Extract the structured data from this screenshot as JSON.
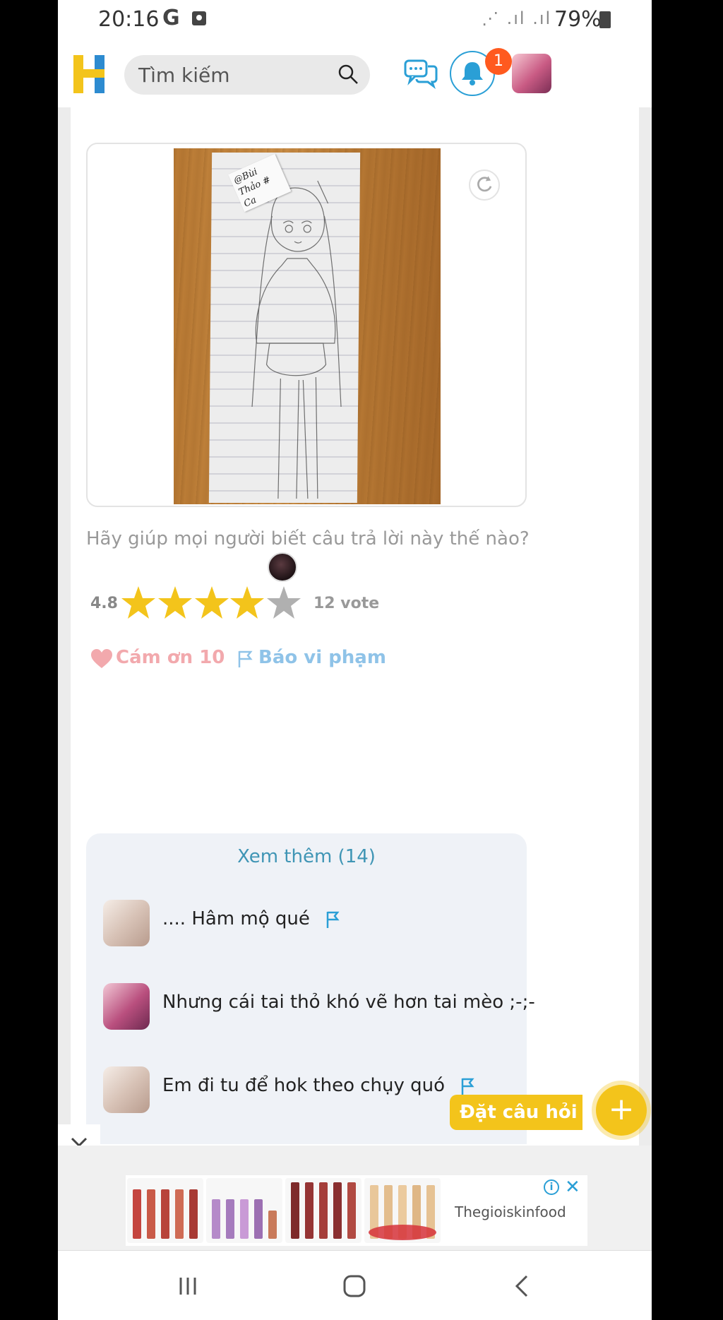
{
  "status_bar": {
    "time": "20:16",
    "g_icon": "G",
    "battery": "79%"
  },
  "header": {
    "search_placeholder": "Tìm kiếm",
    "notification_count": "1"
  },
  "answer": {
    "image_note": "@Bùi Thảo # Ca",
    "prompt": "Hãy giúp mọi người biết câu trả lời này thế nào?",
    "rating_value": "4.8",
    "rating_stars": 4,
    "rating_max": 5,
    "votes": "12 vote",
    "thanks": "Cám ơn 10",
    "report": "Báo vi phạm"
  },
  "comments": {
    "more": "Xem thêm (14)",
    "items": [
      {
        "text": ".... Hâm mộ qué",
        "flag": true
      },
      {
        "text": "Nhưng cái tai thỏ khó vẽ hơn tai mèo ;-;-",
        "flag": false
      },
      {
        "text": "Em đi tu để hok theo chụy quó",
        "flag": true
      }
    ]
  },
  "ask_button": "Đặt câu hỏi",
  "ad": {
    "advertiser": "Thegioiskinfood"
  },
  "colors": {
    "accent_yellow": "#f3c41b",
    "accent_blue": "#2a9fd6",
    "badge_orange": "#ff5a1f"
  }
}
